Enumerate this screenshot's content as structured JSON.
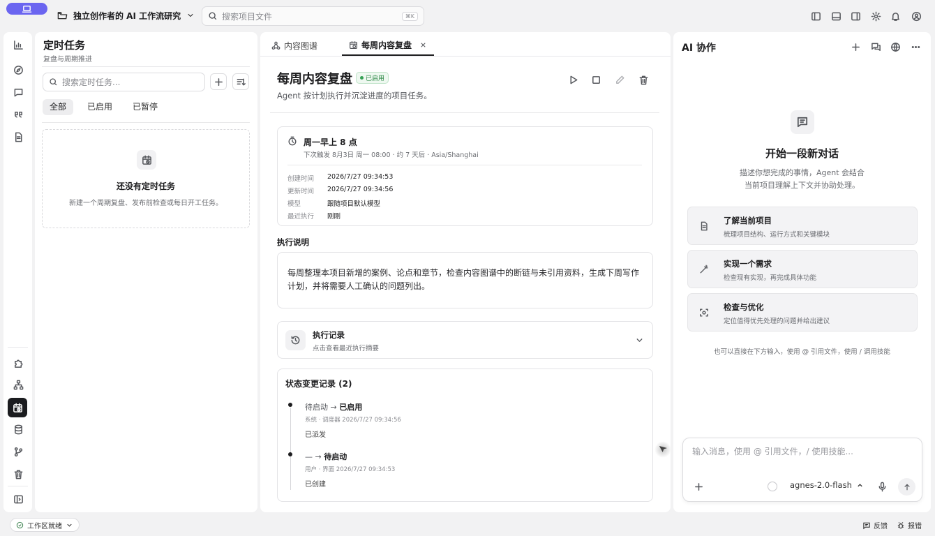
{
  "topbar": {
    "project_name": "独立创作者的 AI 工作流研究",
    "search_placeholder": "搜索项目文件",
    "search_shortcut": "⌘K"
  },
  "tasks": {
    "title": "定时任务",
    "subtitle": "复盘与周期推进",
    "search_placeholder": "搜索定时任务...",
    "filters": [
      "全部",
      "已启用",
      "已暂停"
    ],
    "empty_title": "还没有定时任务",
    "empty_desc": "新建一个周期复盘、发布前检查或每日开工任务。"
  },
  "detail": {
    "tabs": [
      "内容图谱",
      "每周内容复盘"
    ],
    "title": "每周内容复盘",
    "status": "已启用",
    "description": "Agent 按计划执行并沉淀进度的项目任务。",
    "schedule": {
      "title": "周一早上 8 点",
      "next_run": "下次触发 8月3日 周一 08:00 · 约 7 天后 · Asia/Shanghai"
    },
    "meta": [
      {
        "key": "创建时间",
        "value": "2026/7/27 09:34:53"
      },
      {
        "key": "更新时间",
        "value": "2026/7/27 09:34:56"
      },
      {
        "key": "模型",
        "value": "跟随项目默认模型"
      },
      {
        "key": "最近执行",
        "value": "刚刚"
      }
    ],
    "exec_label": "执行说明",
    "exec_text": "每周整理本项目新增的案例、论点和章节，检查内容图谱中的断链与未引用资料，生成下周写作计划，并将需要人工确认的问题列出。",
    "log_title": "执行记录",
    "log_sub": "点击查看最近执行摘要",
    "state_title": "状态变更记录 (2)",
    "state_changes": [
      {
        "from": "待启动",
        "arrow": "→",
        "to": "已启用",
        "meta": "系统 · 调度器  2026/7/27 09:34:56",
        "note": "已派发"
      },
      {
        "from": "—",
        "arrow": "→",
        "to": "待启动",
        "meta": "用户 · 界面  2026/7/27 09:34:53",
        "note": "已创建"
      }
    ]
  },
  "ai": {
    "title": "AI 协作",
    "heading": "开始一段新对话",
    "desc_line1": "描述你想完成的事情，Agent 会结合",
    "desc_line2": "当前项目理解上下文并协助处理。",
    "suggestions": [
      {
        "title": "了解当前项目",
        "desc": "梳理项目结构、运行方式和关键模块"
      },
      {
        "title": "实现一个需求",
        "desc": "检查现有实现，再完成具体功能"
      },
      {
        "title": "检查与优化",
        "desc": "定位值得优先处理的问题并给出建议"
      }
    ],
    "hint": "也可以直接在下方输入，使用 @ 引用文件，使用 / 调用技能",
    "input_placeholder": "输入消息，使用 @ 引用文件，/ 使用技能...",
    "model": "agnes-2.0-flash"
  },
  "statusbar": {
    "workspace": "工作区就绪",
    "feedback": "反馈",
    "report": "报错"
  }
}
